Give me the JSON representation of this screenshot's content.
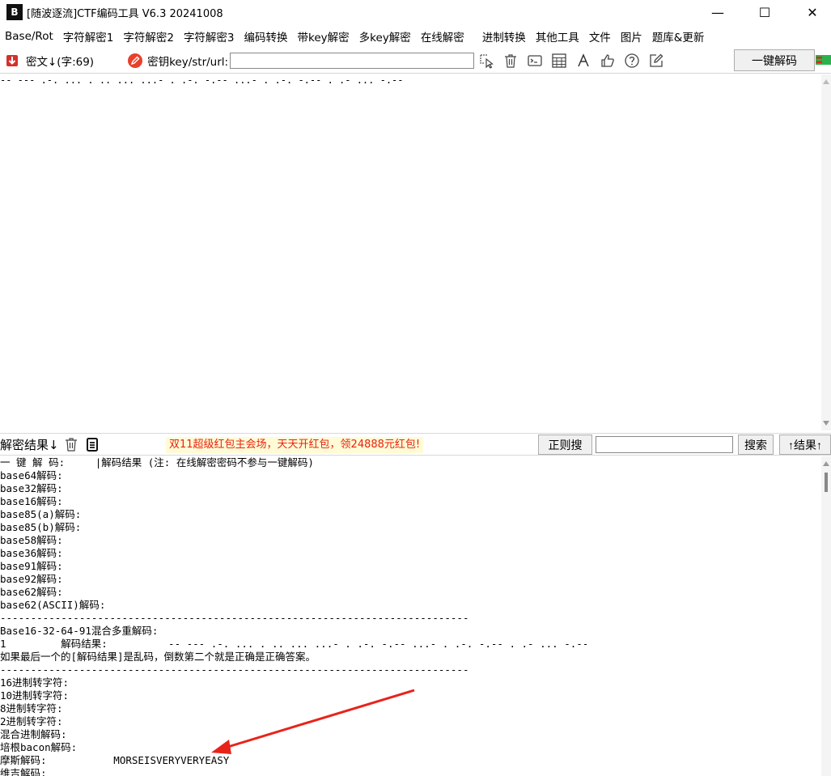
{
  "window": {
    "logo": "B",
    "title": "[随波逐流]CTF编码工具 V6.3 20241008",
    "minimize": "—",
    "maximize": "☐",
    "close": "✕"
  },
  "menu": [
    "Base/Rot",
    "字符解密1",
    "字符解密2",
    "字符解密3",
    "编码转换",
    "带key解密",
    "多key解密",
    "在线解密",
    "进制转换",
    "其他工具",
    "文件",
    "图片",
    "题库&更新"
  ],
  "toolbar": {
    "cipher_label": "密文↓(字:69)",
    "key_label": "密钥key/str/url:",
    "key_value": "",
    "onekey_button": "一键解码",
    "colors": {
      "key_icon": "#e8402a",
      "cipher_icon": "#d6302a"
    }
  },
  "cipher_text": "-- --- .-. ... . .. ... ...- . .-. -.-- ...- . .-. -.-- . .- ... -.--",
  "result_bar": {
    "title": "解密结果↓",
    "promo": "双11超级红包主会场，天天开红包，领24888元红包!",
    "regex_button": "正则搜",
    "search_value": "",
    "search_button": "搜索",
    "result_up_button": "↑结果↑"
  },
  "results": [
    "一 键 解 码:     |解码结果 (注: 在线解密密码不参与一键解码)",
    "base64解码:",
    "base32解码:",
    "base16解码:",
    "base85(a)解码:",
    "base85(b)解码:",
    "base58解码:",
    "base36解码:",
    "base91解码:",
    "base92解码:",
    "base62解码:",
    "base62(ASCII)解码:",
    "-----------------------------------------------------------------------------",
    "Base16-32-64-91混合多重解码:",
    "1         解码结果:          -- --- .-. ... . .. ... ...- . .-. -.-- ...- . .-. -.-- . .- ... -.--",
    "如果最后一个的[解码结果]是乱码，倒数第二个就是正确是正确答案。",
    "-----------------------------------------------------------------------------",
    "16进制转字符:",
    "10进制转字符:",
    "8进制转字符:",
    "2进制转字符:",
    "混合进制解码:",
    "培根bacon解码:",
    "摩斯解码:           MORSEISVERYVERYEASY",
    "维吉解码:"
  ],
  "arrow_color": "#e8231a"
}
